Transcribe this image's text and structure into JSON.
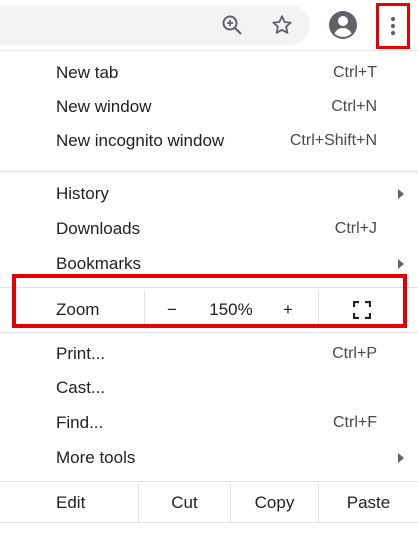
{
  "toolbar": {
    "icons": [
      "zoom-icon",
      "star-icon",
      "profile-icon",
      "menu-icon"
    ],
    "highlight_color": "#e60000"
  },
  "menu": {
    "items_group1": [
      {
        "label": "New tab",
        "shortcut": "Ctrl+T"
      },
      {
        "label": "New window",
        "shortcut": "Ctrl+N"
      },
      {
        "label": "New incognito window",
        "shortcut": "Ctrl+Shift+N"
      }
    ],
    "items_group2": [
      {
        "label": "History",
        "submenu": true
      },
      {
        "label": "Downloads",
        "shortcut": "Ctrl+J"
      },
      {
        "label": "Bookmarks",
        "submenu": true
      }
    ],
    "zoom": {
      "label": "Zoom",
      "minus": "−",
      "level": "150%",
      "plus": "+"
    },
    "items_group3": [
      {
        "label": "Print...",
        "shortcut": "Ctrl+P"
      },
      {
        "label": "Cast..."
      },
      {
        "label": "Find...",
        "shortcut": "Ctrl+F"
      },
      {
        "label": "More tools",
        "submenu": true
      }
    ],
    "edit": {
      "label": "Edit",
      "cut": "Cut",
      "copy": "Copy",
      "paste": "Paste"
    }
  }
}
